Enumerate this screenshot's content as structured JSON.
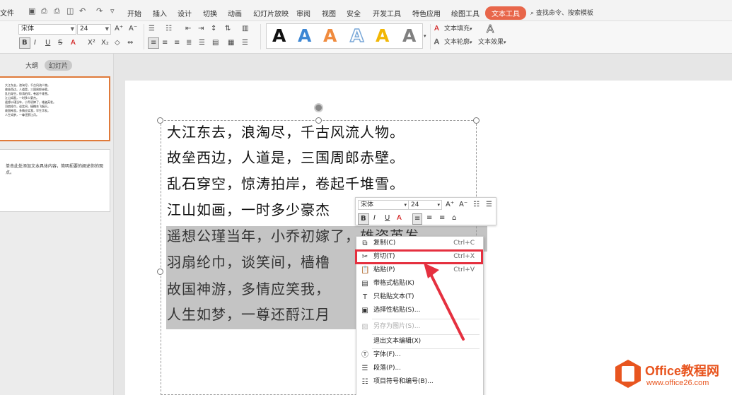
{
  "menubar": {
    "file_label": "文件",
    "tabs": [
      "开始",
      "插入",
      "设计",
      "切换",
      "动画",
      "幻灯片放映",
      "审阅",
      "视图",
      "安全",
      "开发工具",
      "特色应用",
      "绘图工具",
      "文本工具"
    ],
    "active_tab": "文本工具",
    "search_text": "查找命令、搜索模板"
  },
  "ribbon": {
    "font_name": "宋体",
    "font_size": "24",
    "text_fill_label": "文本填充",
    "text_outline_label": "文本轮廓",
    "text_effect_label": "文本效果"
  },
  "wordart_colors": [
    "#111111",
    "#3d87d4",
    "#f08b3e",
    "#7aa8d8",
    "#f2b705",
    "#808080"
  ],
  "left_panel": {
    "tab_outline": "大纲",
    "tab_slides": "幻灯片",
    "thumb1_lines": [
      "大江东去，浪淘尽，千古风流人物。",
      "故垒西边，人道是，三国周郎赤壁。",
      "乱石穿空，惊涛拍岸，卷起千堆雪。",
      "江山如画，一时多少豪杰。",
      "遥想公瑾当年，小乔初嫁了，雄姿英发。",
      "羽扇纶巾，谈笑间，樯橹灰飞烟灭。",
      "故国神游，多情应笑我，早生华发。",
      "人生如梦，一尊还酹江月。"
    ],
    "thumb2_text": "单击此处添加文本具体内容，简明扼要的阐述你的观点。"
  },
  "slide": {
    "lines": [
      "大江东去，浪淘尽，千古风流人物。",
      "故垒西边，人道是，三国周郎赤壁。",
      "乱石穿空，惊涛拍岸，卷起千堆雪。",
      "江山如画，一时多少豪杰",
      "遥想公瑾当年，小乔初嫁了，雄姿英发",
      "羽扇纶巾，谈笑间，樯橹",
      "故国神游，多情应笑我，",
      "人生如梦，一尊还酹江月"
    ]
  },
  "mini_toolbar": {
    "font_name": "宋体",
    "font_size": "24"
  },
  "context_menu": {
    "items": [
      {
        "label": "复制(C)",
        "shortcut": "Ctrl+C",
        "icon": "copy-icon"
      },
      {
        "label": "剪切(T)",
        "shortcut": "Ctrl+X",
        "icon": "scissors-icon"
      },
      {
        "label": "粘贴(P)",
        "shortcut": "Ctrl+V",
        "icon": "paste-icon"
      },
      {
        "label": "带格式粘贴(K)",
        "shortcut": "",
        "icon": "paste-format-icon"
      },
      {
        "label": "只粘贴文本(T)",
        "shortcut": "",
        "icon": "paste-text-icon"
      },
      {
        "label": "选择性粘贴(S)...",
        "shortcut": "",
        "icon": "paste-special-icon"
      },
      {
        "label": "另存为图片(S)...",
        "shortcut": "",
        "icon": "save-image-icon",
        "disabled": true
      },
      {
        "label": "退出文本编辑(X)",
        "shortcut": "",
        "icon": ""
      },
      {
        "label": "字体(F)...",
        "shortcut": "",
        "icon": "font-icon"
      },
      {
        "label": "段落(P)...",
        "shortcut": "",
        "icon": "paragraph-icon"
      },
      {
        "label": "项目符号和编号(B)...",
        "shortcut": "",
        "icon": "bullets-icon"
      }
    ],
    "highlighted": "剪切(T)"
  },
  "logo": {
    "main": "Office教程网",
    "url": "www.office26.com"
  },
  "colors": {
    "accent": "#e8664a",
    "highlight_box": "#e5303f",
    "logo": "#e8551f"
  }
}
